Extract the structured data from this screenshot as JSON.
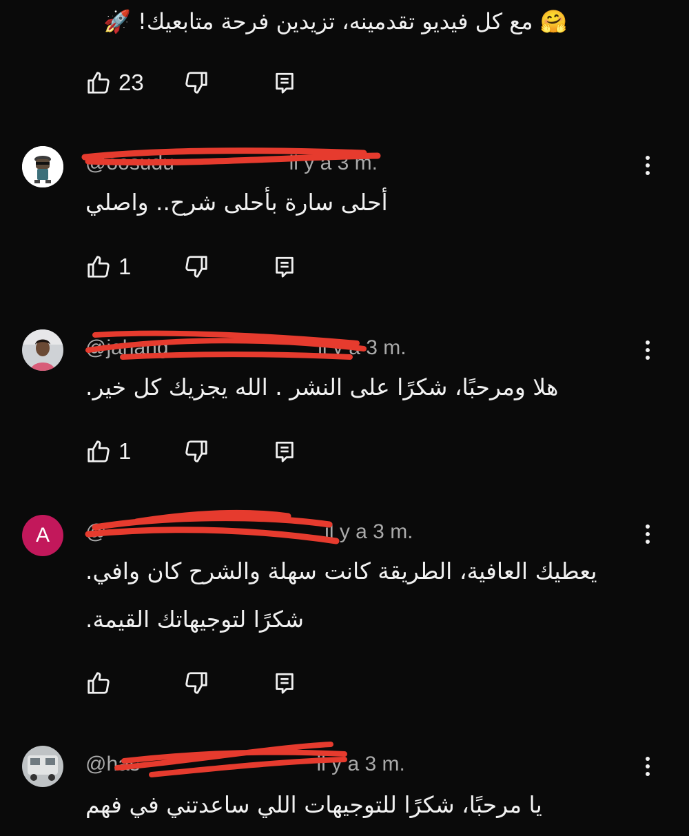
{
  "comments": [
    {
      "handle": "",
      "time": "",
      "text": "🤗 مع كل فيديو تقدمينه، تزيدين فرحة متابعيك! 🚀",
      "likes": "23"
    },
    {
      "handle": "@oosudu",
      "time": "il y a 3 m.",
      "text": "أحلى سارة بأحلى شرح.. واصلي",
      "likes": "1"
    },
    {
      "handle": "@jahang",
      "time": "il y a 3 m.",
      "text": "هلا ومرحبًا، شكرًا على النشر . الله يجزيك كل خير.",
      "likes": "1"
    },
    {
      "handle": "@",
      "time": "il y a 3 m.",
      "avatar_letter": "A",
      "text_line1": "يعطيك العافية، الطريقة كانت سهلة والشرح كان وافي.",
      "text_line2": "شكرًا لتوجيهاتك القيمة.",
      "likes": ""
    },
    {
      "handle": "@has",
      "time": "il y a 3 m.",
      "text": "يا مرحبًا، شكرًا للتوجيهات اللي ساعدتني في فهم",
      "likes": ""
    }
  ],
  "icons": {
    "like": "thumbs-up-icon",
    "dislike": "thumbs-down-icon",
    "reply": "reply-icon",
    "more": "more-vertical-icon"
  },
  "colors": {
    "background": "#0a0a0a",
    "text": "#f1f1f1",
    "meta": "#aaaaaa",
    "redaction": "#e63b2e",
    "letter_avatar": "#c2185b"
  }
}
